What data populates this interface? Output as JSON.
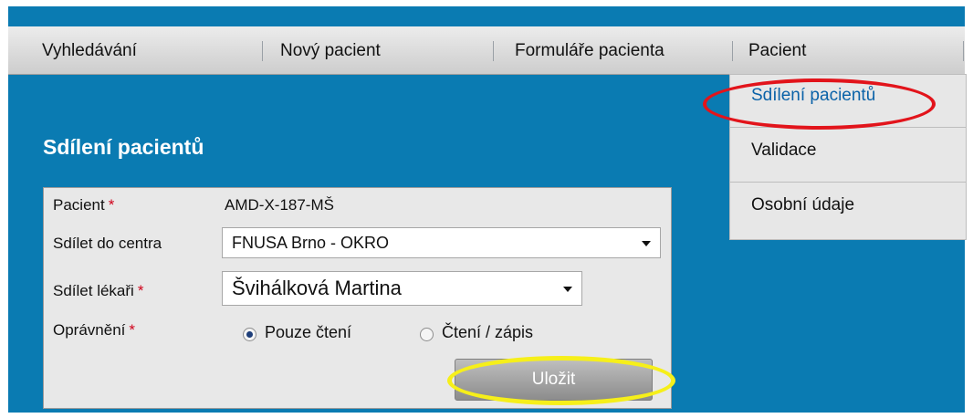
{
  "nav": {
    "items": [
      {
        "label": "Vyhledávání"
      },
      {
        "label": "Nový pacient"
      },
      {
        "label": "Formuláře pacienta"
      },
      {
        "label": "Pacient"
      }
    ]
  },
  "dropdown": {
    "items": [
      {
        "label": "Sdílení pacientů"
      },
      {
        "label": "Validace"
      },
      {
        "label": "Osobní údaje"
      }
    ]
  },
  "section": {
    "title": "Sdílení pacientů"
  },
  "form": {
    "pacient_label": "Pacient",
    "required_mark": "*",
    "pacient_value": "AMD-X-187-MŠ",
    "centre_label": "Sdílet do centra",
    "centre_value": "FNUSA Brno - OKRO",
    "doctor_label": "Sdílet lékaři",
    "doctor_value": "Švihálková Martina",
    "rights_label": "Oprávnění",
    "option_read": "Pouze čtení",
    "option_readwrite": "Čtení / zápis",
    "save_label": "Uložit"
  }
}
